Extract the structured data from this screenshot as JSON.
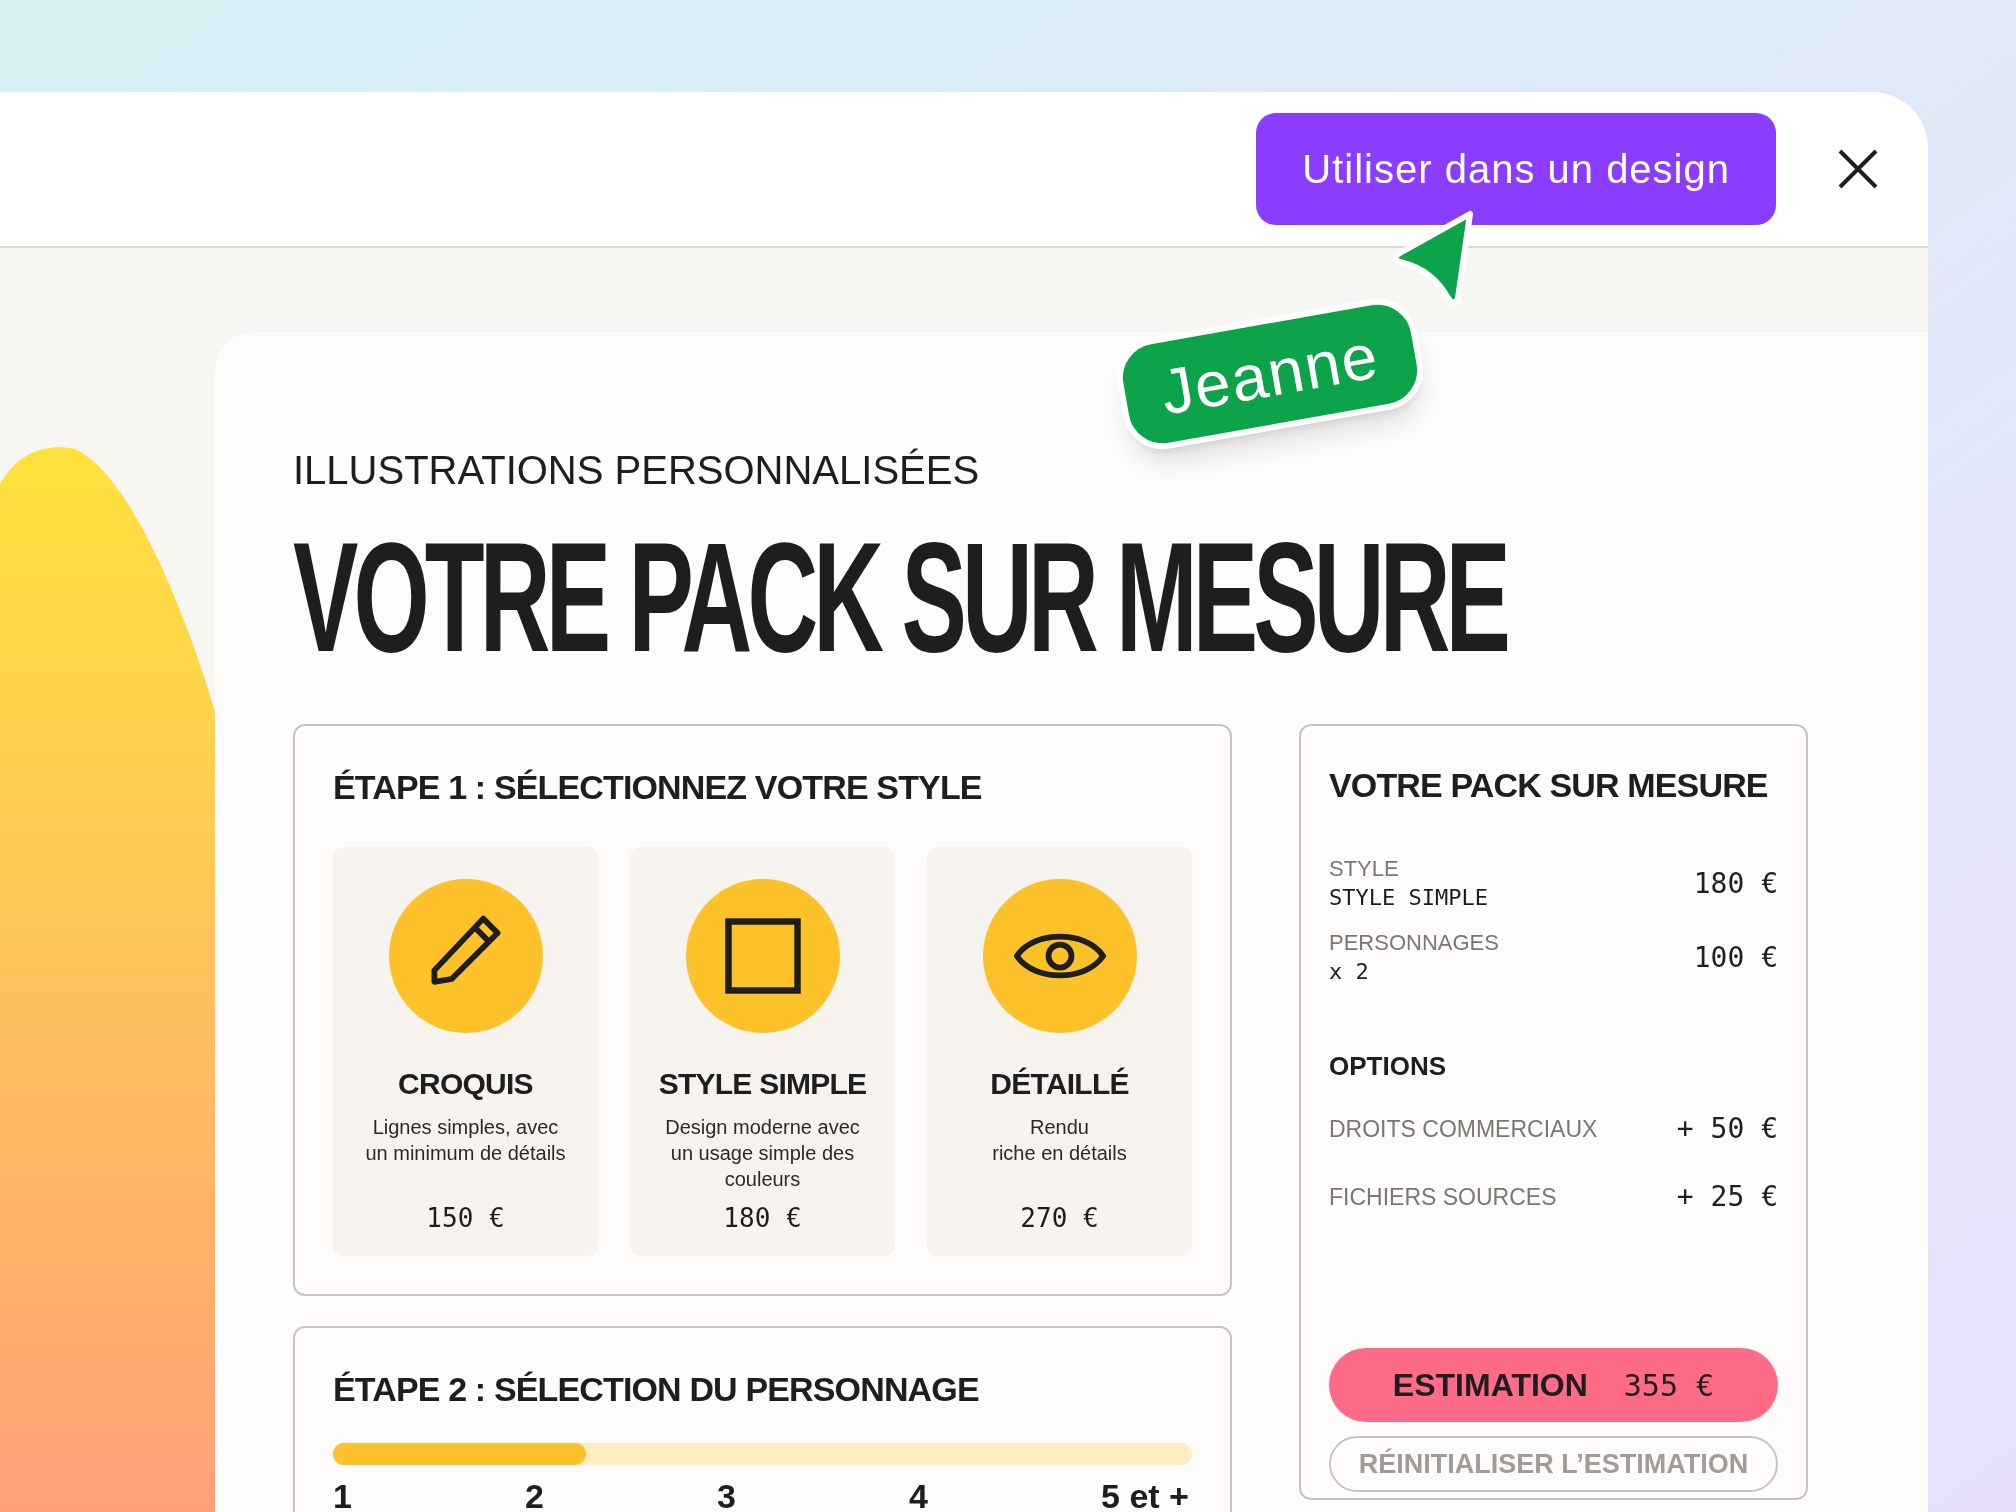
{
  "toolbar": {
    "use_button": "Utiliser dans un design"
  },
  "collaborator_cursor": {
    "name": "Jeanne"
  },
  "page": {
    "eyebrow": "ILLUSTRATIONS PERSONNALISÉES",
    "title": "VOTRE PACK SUR MESURE",
    "step1": {
      "heading": "ÉTAPE 1 : SÉLECTIONNEZ VOTRE STYLE",
      "styles": [
        {
          "name": "CROQUIS",
          "description": "Lignes simples, avec un minimum de détails",
          "price": "150 €"
        },
        {
          "name": "STYLE SIMPLE",
          "description": "Design moderne avec un usage simple des couleurs",
          "price": "180 €"
        },
        {
          "name": "DÉTAILLÉ",
          "description": "Rendu\nriche en détails",
          "price": "270 €"
        }
      ]
    },
    "step2": {
      "heading": "ÉTAPE 2 : SÉLECTION DU PERSONNAGE",
      "slider": {
        "level": 0.295,
        "labels": [
          "1",
          "2",
          "3",
          "4",
          "5 et +"
        ]
      }
    },
    "summary": {
      "heading": "VOTRE PACK SUR MESURE",
      "lines": [
        {
          "label": "STYLE",
          "detail": "STYLE SIMPLE",
          "price": "180 €"
        },
        {
          "label": "PERSONNAGES",
          "detail": "x 2",
          "price": "100 €"
        }
      ],
      "options_heading": "OPTIONS",
      "options": [
        {
          "label": "DROITS COMMERCIAUX",
          "price": "+ 50 €"
        },
        {
          "label": "FICHIERS SOURCES",
          "price": "+ 25 €"
        }
      ],
      "estimate_label": "ESTIMATION",
      "estimate_value": "355 €",
      "reset_button": "RÉINITIALISER L’ESTIMATION"
    }
  }
}
